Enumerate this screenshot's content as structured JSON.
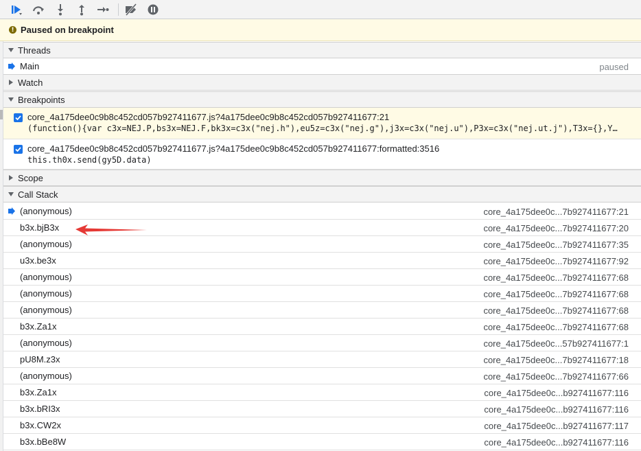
{
  "banner": {
    "text": "Paused on breakpoint"
  },
  "sections": {
    "threads": "Threads",
    "watch": "Watch",
    "breakpoints": "Breakpoints",
    "scope": "Scope",
    "call_stack": "Call Stack"
  },
  "threads": [
    {
      "name": "Main",
      "status": "paused"
    }
  ],
  "breakpoints": [
    {
      "title": "core_4a175dee0c9b8c452cd057b927411677.js?4a175dee0c9b8c452cd057b927411677:21",
      "code": "(function(){var c3x=NEJ.P,bs3x=NEJ.F,bk3x=c3x(\"nej.h\"),eu5z=c3x(\"nej.g\"),j3x=c3x(\"nej.u\"),P3x=c3x(\"nej.ut.j\"),T3x={},Y…",
      "checked": true
    },
    {
      "title": "core_4a175dee0c9b8c452cd057b927411677.js?4a175dee0c9b8c452cd057b927411677:formatted:3516",
      "code": "this.th0x.send(gy5D.data)",
      "checked": true
    }
  ],
  "call_stack": [
    {
      "fn": "(anonymous)",
      "loc": "core_4a175dee0c...7b927411677:21",
      "current": true
    },
    {
      "fn": "b3x.bjB3x",
      "loc": "core_4a175dee0c...7b927411677:20"
    },
    {
      "fn": "(anonymous)",
      "loc": "core_4a175dee0c...7b927411677:35"
    },
    {
      "fn": "u3x.be3x",
      "loc": "core_4a175dee0c...7b927411677:92"
    },
    {
      "fn": "(anonymous)",
      "loc": "core_4a175dee0c...7b927411677:68"
    },
    {
      "fn": "(anonymous)",
      "loc": "core_4a175dee0c...7b927411677:68"
    },
    {
      "fn": "(anonymous)",
      "loc": "core_4a175dee0c...7b927411677:68"
    },
    {
      "fn": "b3x.Za1x",
      "loc": "core_4a175dee0c...7b927411677:68"
    },
    {
      "fn": "(anonymous)",
      "loc": "core_4a175dee0c...57b927411677:1"
    },
    {
      "fn": "pU8M.z3x",
      "loc": "core_4a175dee0c...7b927411677:18"
    },
    {
      "fn": "(anonymous)",
      "loc": "core_4a175dee0c...7b927411677:66"
    },
    {
      "fn": "b3x.Za1x",
      "loc": "core_4a175dee0c...b927411677:116"
    },
    {
      "fn": "b3x.bRI3x",
      "loc": "core_4a175dee0c...b927411677:116"
    },
    {
      "fn": "b3x.CW2x",
      "loc": "core_4a175dee0c...b927411677:117"
    },
    {
      "fn": "b3x.bBe8W",
      "loc": "core_4a175dee0c...b927411677:116"
    }
  ],
  "colors": {
    "accent": "#1a73e8",
    "paused_bg": "#fffbe5",
    "annotation_arrow": "#e53935"
  },
  "icons": {
    "toolbar": [
      "resume-icon",
      "step-over-icon",
      "step-into-icon",
      "step-out-icon",
      "step-icon",
      "deactivate-breakpoints-icon",
      "pause-on-exceptions-icon"
    ]
  }
}
